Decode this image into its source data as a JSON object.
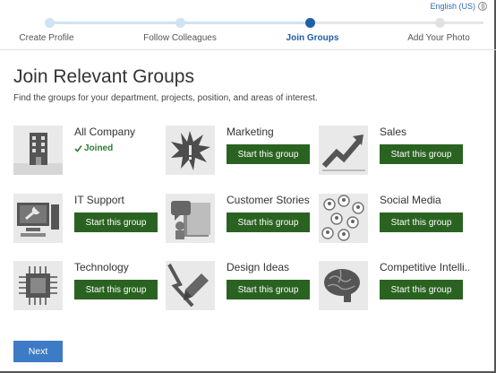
{
  "language": {
    "label": "English (US)"
  },
  "steps": [
    {
      "label": "Create Profile",
      "state": "done"
    },
    {
      "label": "Follow Colleagues",
      "state": "done"
    },
    {
      "label": "Join Groups",
      "state": "active"
    },
    {
      "label": "Add Your Photo",
      "state": "todo"
    }
  ],
  "page": {
    "title": "Join Relevant Groups",
    "subtitle": "Find the groups for your department, projects, position, and areas of interest."
  },
  "groups": [
    {
      "name": "All Company",
      "icon": "building-icon",
      "joined": true,
      "status_text": "Joined"
    },
    {
      "name": "Marketing",
      "icon": "starburst-icon",
      "joined": false,
      "button": "Start this group"
    },
    {
      "name": "Sales",
      "icon": "rising-chart-icon",
      "joined": false,
      "button": "Start this group"
    },
    {
      "name": "IT Support",
      "icon": "computer-wrench-icon",
      "joined": false,
      "button": "Start this group"
    },
    {
      "name": "Customer Stories",
      "icon": "speech-book-icon",
      "joined": false,
      "button": "Start this group"
    },
    {
      "name": "Social Media",
      "icon": "people-network-icon",
      "joined": false,
      "button": "Start this group"
    },
    {
      "name": "Technology",
      "icon": "chip-icon",
      "joined": false,
      "button": "Start this group"
    },
    {
      "name": "Design Ideas",
      "icon": "pencil-icon",
      "joined": false,
      "button": "Start this group"
    },
    {
      "name": "Competitive Intelli...",
      "icon": "brain-icon",
      "joined": false,
      "button": "Start this group"
    }
  ],
  "footer": {
    "next_label": "Next"
  },
  "colors": {
    "accent": "#1f5ea8",
    "button_green": "#2a6321",
    "next_blue": "#3e7bc6",
    "joined_green": "#2f7d32"
  }
}
